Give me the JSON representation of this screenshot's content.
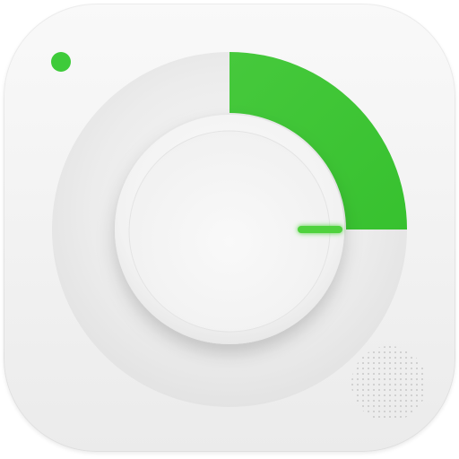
{
  "app_icon": {
    "kind": "timer-dial",
    "icon": "knob-timer-icon",
    "colors": {
      "accent": "#3fc63a",
      "accent_light": "#5fdc4c",
      "surface": "#f3f3f3",
      "ring": "#e9e9e9",
      "knob": "#f7f7f7"
    },
    "timer_arc_fraction": 0.25,
    "status_dot_color": "#3ecb3a",
    "indicator_color": "#4fd23e"
  }
}
